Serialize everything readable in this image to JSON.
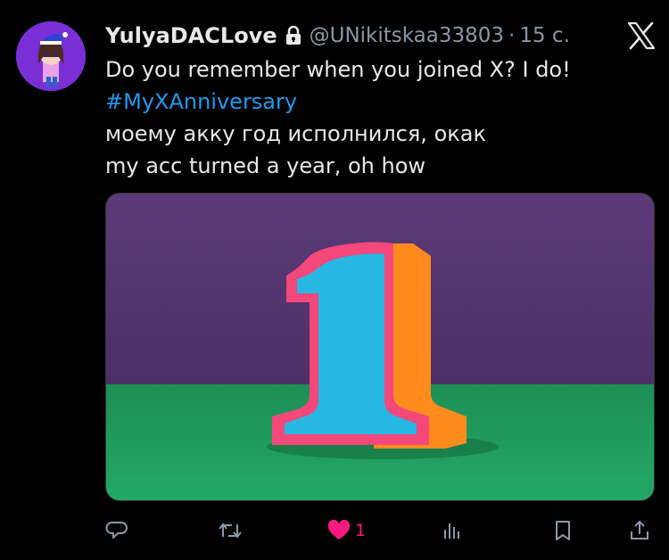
{
  "tweet": {
    "author_name": "YulyaDACLove",
    "handle": "@UNikitskaa33803",
    "separator": "·",
    "time": "15 с.",
    "lines": [
      "Do you remember when you joined X? I do!",
      "#MyXAnniversary",
      "моему акку год исполнился, окак",
      "my acc turned a year, oh how"
    ]
  },
  "actions": {
    "reply": {
      "icon": "reply-icon"
    },
    "repost": {
      "icon": "repost-icon"
    },
    "like": {
      "icon": "heart-icon",
      "count": "1",
      "liked": true,
      "color": "#f91880"
    },
    "views": {
      "icon": "views-icon"
    },
    "bookmark": {
      "icon": "bookmark-icon"
    },
    "share": {
      "icon": "share-icon"
    }
  },
  "colors": {
    "background": "#000000",
    "text": "#e7e9ea",
    "secondary": "#8b98a5",
    "link": "#1d9bf0",
    "like": "#f91880"
  }
}
